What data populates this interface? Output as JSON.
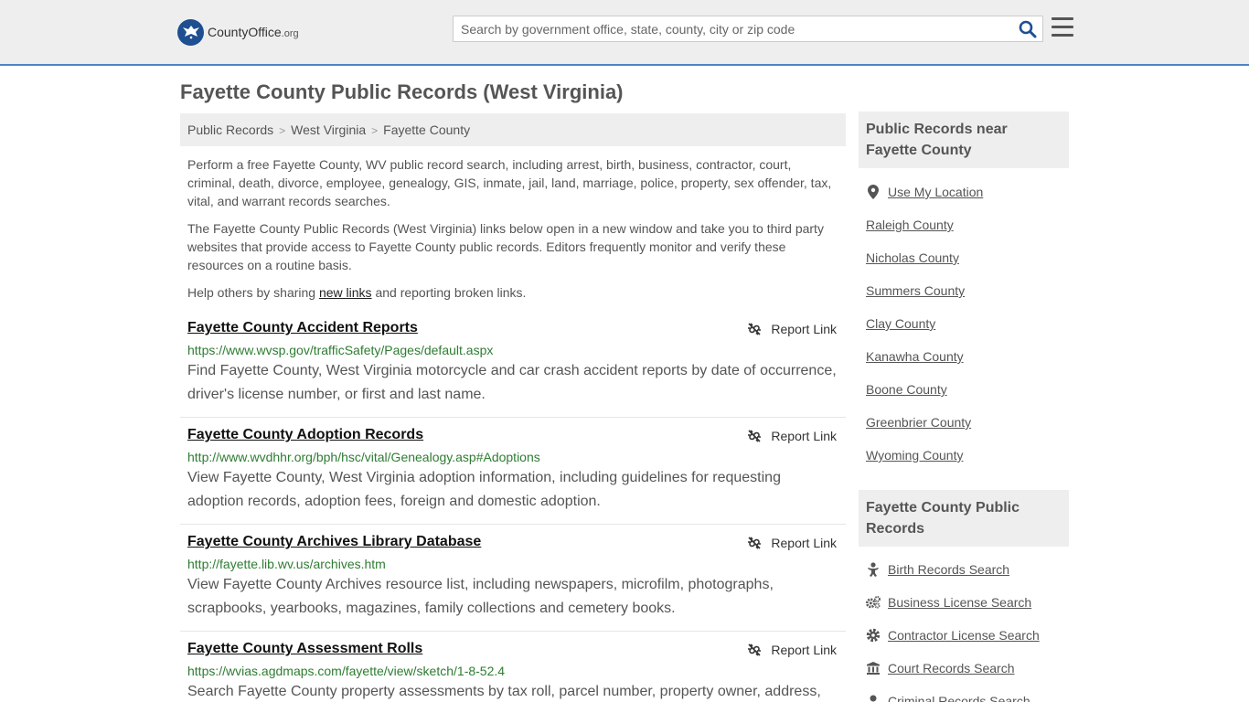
{
  "header": {
    "logo_text": "CountyOffice",
    "logo_suffix": ".org",
    "search_placeholder": "Search by government office, state, county, city or zip code"
  },
  "page": {
    "title": "Fayette County Public Records (West Virginia)"
  },
  "breadcrumb": [
    "Public Records",
    "West Virginia",
    "Fayette County"
  ],
  "intro": {
    "p1": "Perform a free Fayette County, WV public record search, including arrest, birth, business, contractor, court, criminal, death, divorce, employee, genealogy, GIS, inmate, jail, land, marriage, police, property, sex offender, tax, vital, and warrant records searches.",
    "p2": "The Fayette County Public Records (West Virginia) links below open in a new window and take you to third party websites that provide access to Fayette County public records. Editors frequently monitor and verify these resources on a routine basis.",
    "p3_before": "Help others by sharing ",
    "p3_link": "new links",
    "p3_after": " and reporting broken links."
  },
  "report_label": "Report Link",
  "records": [
    {
      "title": "Fayette County Accident Reports",
      "url": "https://www.wvsp.gov/trafficSafety/Pages/default.aspx",
      "desc": "Find Fayette County, West Virginia motorcycle and car crash accident reports by date of occurrence, driver's license number, or first and last name."
    },
    {
      "title": "Fayette County Adoption Records",
      "url": "http://www.wvdhhr.org/bph/hsc/vital/Genealogy.asp#Adoptions",
      "desc": "View Fayette County, West Virginia adoption information, including guidelines for requesting adoption records, adoption fees, foreign and domestic adoption."
    },
    {
      "title": "Fayette County Archives Library Database",
      "url": "http://fayette.lib.wv.us/archives.htm",
      "desc": "View Fayette County Archives resource list, including newspapers, microfilm, photographs, scrapbooks, yearbooks, magazines, family collections and cemetery books."
    },
    {
      "title": "Fayette County Assessment Rolls",
      "url": "https://wvias.agdmaps.com/fayette/view/sketch/1-8-52.4",
      "desc": "Search Fayette County property assessments by tax roll, parcel number, property owner, address,"
    }
  ],
  "sidebar": {
    "near_heading": "Public Records near Fayette County",
    "use_location": "Use My Location",
    "near": [
      "Raleigh County",
      "Nicholas County",
      "Summers County",
      "Clay County",
      "Kanawha County",
      "Boone County",
      "Greenbrier County",
      "Wyoming County"
    ],
    "records_heading": "Fayette County Public Records",
    "records": [
      {
        "label": "Birth Records Search",
        "icon": "baby-icon"
      },
      {
        "label": "Business License Search",
        "icon": "gears-icon"
      },
      {
        "label": "Contractor License Search",
        "icon": "gear-icon"
      },
      {
        "label": "Court Records Search",
        "icon": "courthouse-icon"
      },
      {
        "label": "Criminal Records Search",
        "icon": "criminal-icon"
      }
    ]
  }
}
